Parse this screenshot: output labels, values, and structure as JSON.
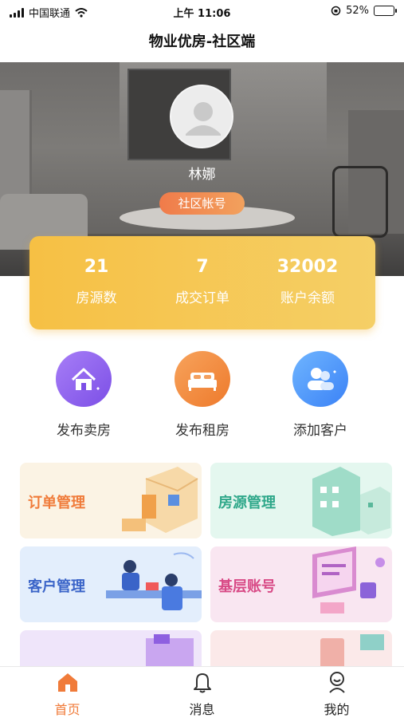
{
  "status_bar": {
    "carrier": "中国联通",
    "time": "上午 11:06",
    "battery": "52%",
    "battery_level": 0.52
  },
  "header": {
    "title": "物业优房-社区端"
  },
  "profile": {
    "name": "林娜",
    "badge": "社区帐号"
  },
  "stats": [
    {
      "value": "21",
      "label": "房源数"
    },
    {
      "value": "7",
      "label": "成交订单"
    },
    {
      "value": "32002",
      "label": "账户余额"
    }
  ],
  "actions": [
    {
      "label": "发布卖房",
      "icon": "house-icon",
      "color": "#8b5cf6"
    },
    {
      "label": "发布租房",
      "icon": "bed-icon",
      "color": "#f08a3c"
    },
    {
      "label": "添加客户",
      "icon": "users-icon",
      "color": "#3b82f6"
    }
  ],
  "tiles": [
    {
      "title": "订单管理",
      "color": "#f07b3a",
      "bg": "#fbf3e4"
    },
    {
      "title": "房源管理",
      "color": "#2fa88a",
      "bg": "#e4f7ef"
    },
    {
      "title": "客户管理",
      "color": "#3a64c8",
      "bg": "#e3eefc"
    },
    {
      "title": "基层账号",
      "color": "#d84a86",
      "bg": "#f9e6f1"
    }
  ],
  "bottom_nav": [
    {
      "label": "首页",
      "icon": "home-icon",
      "active": true
    },
    {
      "label": "消息",
      "icon": "bell-icon",
      "active": false
    },
    {
      "label": "我的",
      "icon": "profile-icon",
      "active": false
    }
  ],
  "colors": {
    "accent": "#f07b3a",
    "card": "#f6c044"
  }
}
